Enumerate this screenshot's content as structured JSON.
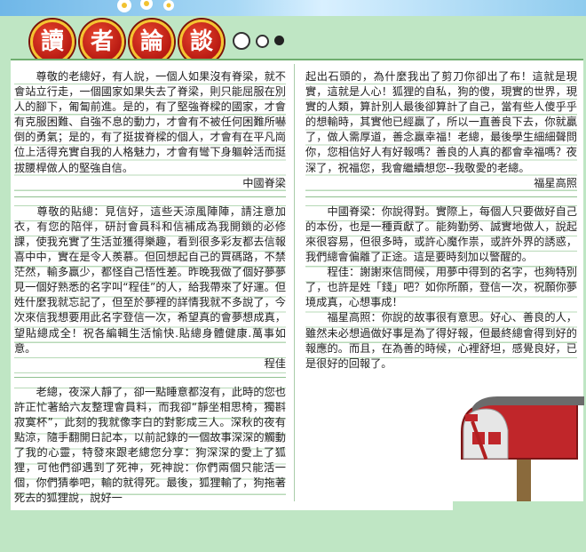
{
  "header": {
    "title_chars": [
      "讀",
      "者",
      "論",
      "談"
    ]
  },
  "colors": {
    "title_red": "#c9231a",
    "title_ring": "#f5c430",
    "background": "#bfe6c4",
    "rule": "#b7d9b7"
  },
  "left": {
    "letter1": {
      "body": "　　尊敬的老總好，有人說，一個人如果沒有脊梁，就不會站立行走，一個國家如果失去了脊梁，則只能屈服在別人的腳下，匍匐前進。是的，有了堅強脊樑的國家，才會有克服困難、自強不息的動力，才會有不被任何困難所嚇倒的勇氣；是的，有了挺拔脊樑的個人，才會有在平凡崗位上活得充實自我的人格魅力，才會有彎下身軀幹活而挺拔腰桿做人的堅強自信。",
      "sig": "中國脊梁"
    },
    "letter2": {
      "body": "　　尊敬的貼總：見信好，這些天涼風陣陣，請注意加衣，有您的陪伴，研討會員科和信補成為我開鎖的必修課，使我充實了生活並獲得樂趣，看到很多彩友都去信報喜中中，實在是令人羨慕。但回想起自己的買碼路，不禁茫然，輸多贏少，都怪自己悟性差。昨晚我做了個好夢夢見一個好熟悉的名字叫“程佳”的人，給我帶來了好運。但姓什麼我就忘記了，但至於夢裡的詳情我就不多說了，今次來信我想要用此名字登信一次，希望真的會夢想成真，望貼總成全！祝各編輯生活愉快.貼總身體健康.萬事如意。",
      "sig": "程佳"
    },
    "letter3": {
      "body": "　　老總，夜深人靜了，卻一點睡意都沒有，此時的您也許正忙著給六友整理會員料，而我卻“靜坐相思椅，獨斟寂寞杯”，此刻的我就像李白的對影成三人。深秋的夜有點涼，隨手翻開日記本，以前記錄的一個故事深深的觸動了我的心靈，特發來跟老總您分享：狗深深的愛上了狐狸，可他們卻遇到了死神，死神說：你們兩個只能活一個，你們猜拳吧，輸的就得死。最後，狐狸輸了，狗拖著死去的狐狸說，說好一"
    }
  },
  "right": {
    "letter3_cont": {
      "body": "起出石頭的，為什麼我出了剪刀你卻出了布！這就是現實，這就是人心！狐狸的自私，狗的傻，現實的世界，現實的人類，算計別人最後卻算計了自己，當有些人傻乎乎的想輸時，其實他已經贏了，所以一直善良下去，你就贏了，做人需厚道，善念贏幸福！老總，最後學生細細聲問你，您相信好人有好報嗎？善良的人真的都會幸福嗎？夜深了，祝福您，我會繼續想您--我敬愛的老總。",
      "sig": "福星高照"
    },
    "replies": [
      "　　中國脊梁：你說得對。實際上，每個人只要做好自己的本份，也是一種貢獻了。能夠勤勞、誠實地做人，說起來很容易，但很多時，或許心魔作祟，或許外界的誘惑，我們總會偏離了正途。這是要時刻加以警醒的。",
      "　　程佳：謝謝來信問候，用夢中得到的名字，也夠特別了，也許是姓「錢」吧？如你所願，登信一次，祝願你夢境成真，心想事成！",
      "　　福星高照：你說的故事很有意思。好心、善良的人，雖然未必想過做好事是為了得好報，但最終總會得到好的報應的。而且，在為善的時候，心裡舒坦，感覺良好，已是很好的回報了。"
    ]
  }
}
